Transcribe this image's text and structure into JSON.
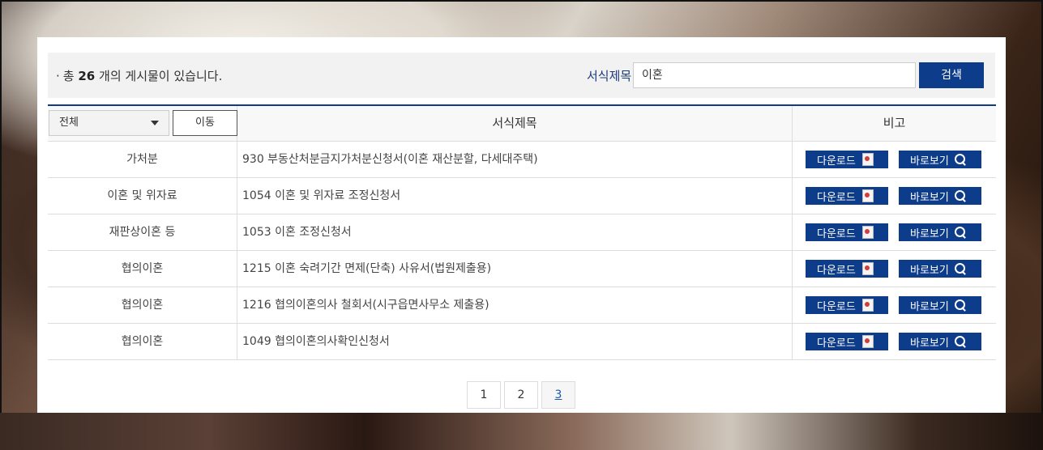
{
  "summary": {
    "prefix": "총",
    "count": "26",
    "suffix": "개의 게시물이 있습니다."
  },
  "search": {
    "label": "서식제목",
    "value": "이혼",
    "button": "검색"
  },
  "filter": {
    "selected": "전체",
    "move_button": "이동"
  },
  "table": {
    "col_title": "서식제목",
    "col_note": "비고",
    "rows": [
      {
        "category": "가처분",
        "title": "930 부동산처분금지가처분신청서(이혼 재산분할, 다세대주택)"
      },
      {
        "category": "이혼 및 위자료",
        "title": "1054 이혼 및 위자료 조정신청서"
      },
      {
        "category": "재판상이혼 등",
        "title": "1053 이혼 조정신청서"
      },
      {
        "category": "협의이혼",
        "title": "1215 이혼 숙려기간 면제(단축) 사유서(법원제출용)"
      },
      {
        "category": "협의이혼",
        "title": "1216 협의이혼의사 철회서(시구읍면사무소 제출용)"
      },
      {
        "category": "협의이혼",
        "title": "1049 협의이혼의사확인신청서"
      }
    ],
    "download_label": "다운로드",
    "view_label": "바로보기"
  },
  "pagination": {
    "pages": [
      "1",
      "2",
      "3"
    ],
    "current": "3"
  },
  "colors": {
    "accent": "#0d3c8a"
  }
}
